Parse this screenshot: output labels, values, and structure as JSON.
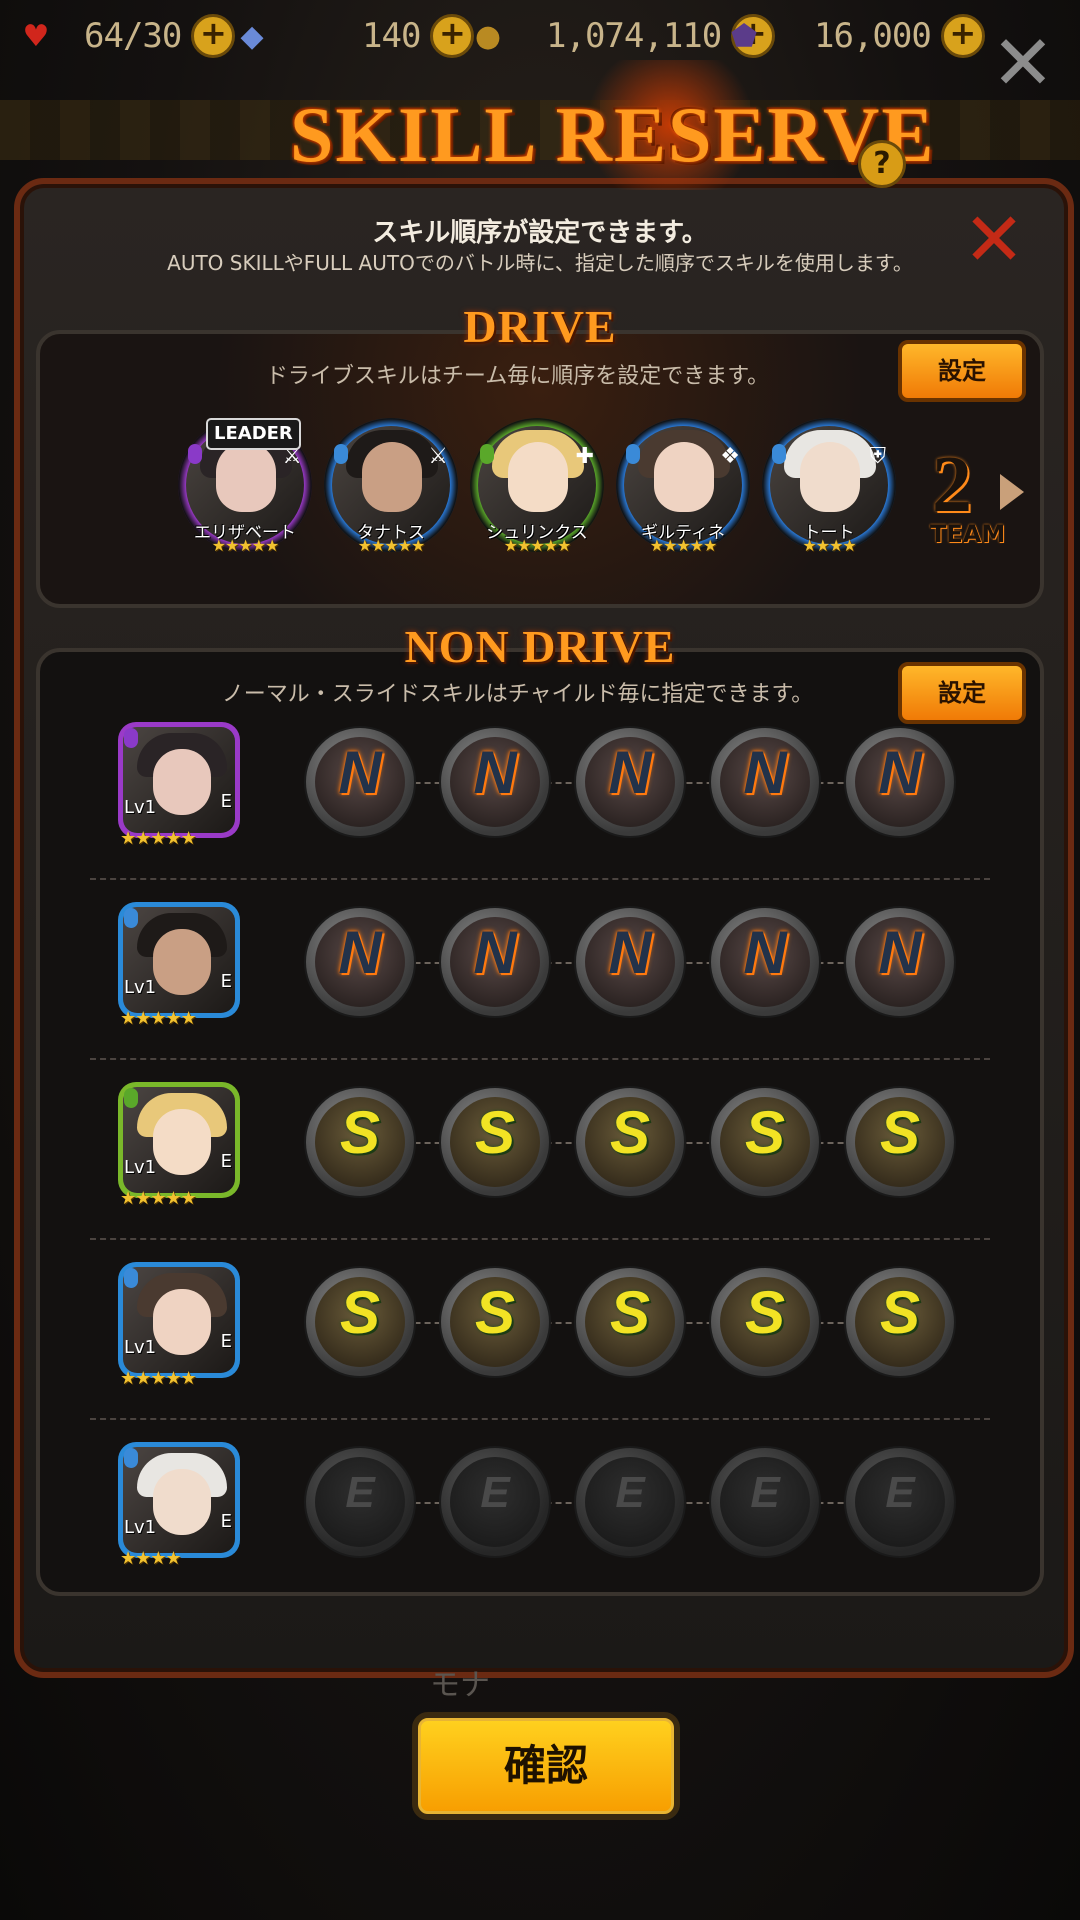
{
  "resources": [
    {
      "icon": "heart-icon",
      "value": "64/30",
      "color": "#d1261c"
    },
    {
      "icon": "crystal-icon",
      "value": "140",
      "color": "#6a8ad8"
    },
    {
      "icon": "coin-icon",
      "value": "1,074,110",
      "color": "#b98a22"
    },
    {
      "icon": "dark-gem-icon",
      "value": "16,000",
      "color": "#5b3c8a"
    }
  ],
  "title": "SKILL RESERVE",
  "subtitle": "スキル順序が設定できます。",
  "subtitle2": "AUTO SKILLやFULL AUTOでのバトル時に、指定した順序でスキルを使用します。",
  "drive": {
    "title": "DRIVE",
    "description": "ドライブスキルはチーム毎に順序を設定できます。",
    "set_label": "設定",
    "leader_label": "LEADER",
    "team_number": "2",
    "team_label": "TEAM",
    "members": [
      {
        "name": "エリザベート",
        "stars": "★★★★★",
        "ring": "#9a3ac8",
        "element": "#8a3ac8",
        "role": "⚔",
        "hair": "#2a2426",
        "face": "#e8c8bc"
      },
      {
        "name": "タナトス",
        "stars": "★★★★★",
        "ring": "#2a7ad8",
        "element": "#3a8ad8",
        "role": "⚔",
        "hair": "#1e1a18",
        "face": "#c99f84"
      },
      {
        "name": "シュリンクス",
        "stars": "★★★★★",
        "ring": "#5aa82a",
        "element": "#5aa82a",
        "role": "✚",
        "hair": "#e8c87a",
        "face": "#f4dcc6"
      },
      {
        "name": "ギルティネ",
        "stars": "★★★★★",
        "ring": "#2a7ad8",
        "element": "#3a8ad8",
        "role": "❖",
        "hair": "#4a3a30",
        "face": "#efd3c2"
      },
      {
        "name": "トート",
        "stars": "★★★★",
        "ring": "#2a7ad8",
        "element": "#3a8ad8",
        "role": "⛨",
        "hair": "#e8e6e2",
        "face": "#f0dccc"
      }
    ]
  },
  "nondrive": {
    "title": "NON DRIVE",
    "description": "ノーマル・スライドスキルはチャイルド毎に指定できます。",
    "set_label": "設定",
    "rows": [
      {
        "level": "Lv1",
        "equip": "E",
        "stars": "★★★★★",
        "border": "#9a3ac8",
        "element": "#8a3ac8",
        "hair": "#2a2426",
        "face": "#e8c8bc",
        "slot_type": "n",
        "slot_letter": "N"
      },
      {
        "level": "Lv1",
        "equip": "E",
        "stars": "★★★★★",
        "border": "#2a8ad8",
        "element": "#3a8ad8",
        "hair": "#1e1a18",
        "face": "#c99f84",
        "slot_type": "n",
        "slot_letter": "N"
      },
      {
        "level": "Lv1",
        "equip": "E",
        "stars": "★★★★★",
        "border": "#7ab82a",
        "element": "#5aa82a",
        "hair": "#e8c87a",
        "face": "#f4dcc6",
        "slot_type": "s",
        "slot_letter": "S"
      },
      {
        "level": "Lv1",
        "equip": "E",
        "stars": "★★★★★",
        "border": "#2a8ad8",
        "element": "#3a8ad8",
        "hair": "#4a3a30",
        "face": "#efd3c2",
        "slot_type": "s",
        "slot_letter": "S"
      },
      {
        "level": "Lv1",
        "equip": "E",
        "stars": "★★★★",
        "border": "#2a8ad8",
        "element": "#3a8ad8",
        "hair": "#e8e6e2",
        "face": "#f0dccc",
        "slot_type": "e",
        "slot_letter": "E"
      }
    ]
  },
  "background_hint": "モナ",
  "confirm_label": "確認"
}
